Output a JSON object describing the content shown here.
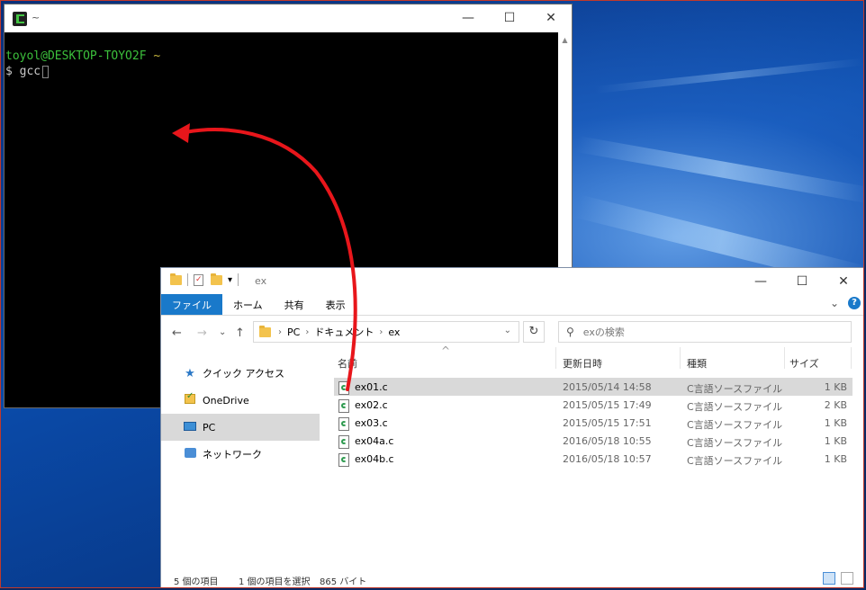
{
  "terminal": {
    "title": "~",
    "prompt_user": "toyol@DESKTOP-TOYO2F",
    "prompt_tilde": "~",
    "command_line": "$ gcc",
    "buttons": {
      "minimize": "—",
      "maximize": "☐",
      "close": "✕"
    },
    "scroll_up": "▲"
  },
  "explorer": {
    "title": "ex",
    "quick_access_dropdown": "▾",
    "buttons": {
      "minimize": "—",
      "maximize": "☐",
      "close": "✕"
    },
    "ribbon": {
      "tabs": [
        "ファイル",
        "ホーム",
        "共有",
        "表示"
      ],
      "expand": "⌄",
      "help": "?"
    },
    "nav": {
      "back": "←",
      "forward": "→",
      "recent": "⌄",
      "up": "↑"
    },
    "address": {
      "crumbs": [
        "PC",
        "ドキュメント",
        "ex"
      ],
      "separator": "›",
      "dropdown": "⌄"
    },
    "refresh": "↻",
    "search_placeholder": "exの検索",
    "search_icon": "⚲",
    "navpane": [
      {
        "label": "クイック アクセス",
        "icon": "star-icon",
        "selected": false
      },
      {
        "label": "OneDrive",
        "icon": "onedrive-icon",
        "selected": false
      },
      {
        "label": "PC",
        "icon": "pc-icon",
        "selected": true
      },
      {
        "label": "ネットワーク",
        "icon": "network-icon",
        "selected": false
      }
    ],
    "columns": {
      "name": "名前",
      "modified": "更新日時",
      "type": "種類",
      "size": "サイズ",
      "sort_caret": "^"
    },
    "files": [
      {
        "name": "ex01.c",
        "modified": "2015/05/14 14:58",
        "type": "C言語ソースファイル",
        "size": "1 KB",
        "selected": true
      },
      {
        "name": "ex02.c",
        "modified": "2015/05/15 17:49",
        "type": "C言語ソースファイル",
        "size": "2 KB",
        "selected": false
      },
      {
        "name": "ex03.c",
        "modified": "2015/05/15 17:51",
        "type": "C言語ソースファイル",
        "size": "1 KB",
        "selected": false
      },
      {
        "name": "ex04a.c",
        "modified": "2016/05/18 10:55",
        "type": "C言語ソースファイル",
        "size": "1 KB",
        "selected": false
      },
      {
        "name": "ex04b.c",
        "modified": "2016/05/18 10:57",
        "type": "C言語ソースファイル",
        "size": "1 KB",
        "selected": false
      }
    ],
    "status": {
      "count": "5 個の項目",
      "selection": "1 個の項目を選択",
      "selection_size": "865 バイト"
    }
  },
  "annotation": {
    "color": "#e8161b"
  }
}
